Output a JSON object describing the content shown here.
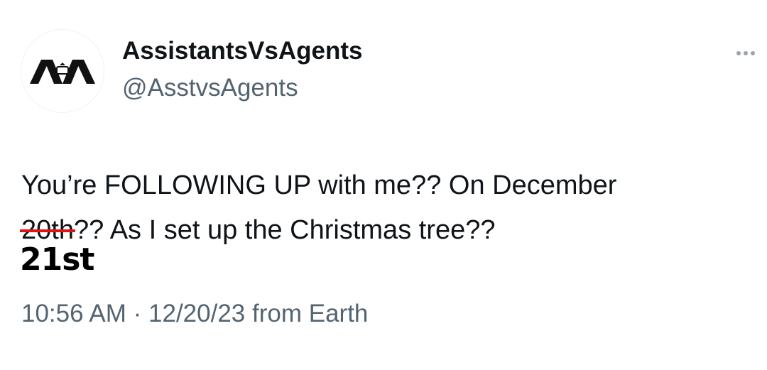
{
  "author": {
    "display_name": "AssistantsVsAgents",
    "handle": "@AsstvsAgents",
    "avatar_icon": "ava-logo-icon"
  },
  "more_icon": "more-horizontal-icon",
  "tweet": {
    "line1": "You’re FOLLOWING UP with me?? On December",
    "struck_text": "20th",
    "line2_rest": "?? As I set up the Christmas tree??",
    "correction": "21st",
    "strike_color": "#e01212"
  },
  "meta": {
    "time": "10:56 AM",
    "separator": "·",
    "date": "12/20/23",
    "source": "from Earth"
  }
}
